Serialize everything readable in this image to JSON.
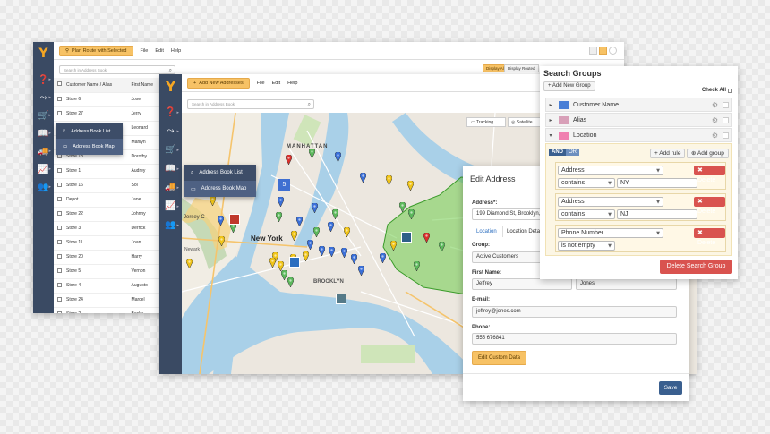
{
  "win1": {
    "route_button": "Plan Route with Selected",
    "menu": [
      "File",
      "Edit",
      "Help"
    ],
    "search_placeholder": "Search in Address Book",
    "display_all": "Display All",
    "display_routed": "Display Routed",
    "columns": [
      "Customer Name / Alias",
      "First Name"
    ],
    "rows": [
      [
        "Store 6",
        "Jose"
      ],
      [
        "Store 27",
        "Jerry"
      ],
      [
        "Store 13",
        "Leonard"
      ],
      [
        "Store 9",
        "Marilyn"
      ],
      [
        "Store 18",
        "Dorothy"
      ],
      [
        "Store 1",
        "Audrey"
      ],
      [
        "Store 16",
        "Sol"
      ],
      [
        "Depot",
        "Jane"
      ],
      [
        "Store 22",
        "Johnny"
      ],
      [
        "Store 3",
        "Derrick"
      ],
      [
        "Store 11",
        "Joan"
      ],
      [
        "Store 20",
        "Harry"
      ],
      [
        "Store 5",
        "Vernon"
      ],
      [
        "Store 4",
        "Augusto"
      ],
      [
        "Store 24",
        "Marcel"
      ],
      [
        "Store 2",
        "Becky"
      ]
    ],
    "flyout": [
      "Address Book List",
      "Address Book Map"
    ]
  },
  "win2": {
    "add_button": "Add New Addresses",
    "menu": [
      "File",
      "Edit",
      "Help"
    ],
    "search_placeholder": "Search in Address Book",
    "map_tracking": "Tracking",
    "map_satellite": "Satellite",
    "flyout": [
      "Address Book List",
      "Address Book Map"
    ],
    "map_labels": {
      "ny": "New York",
      "brooklyn": "BROOKLYN",
      "manhattan": "MANHATTAN",
      "jersey": "Jersey C",
      "newark": "Newark"
    }
  },
  "edit": {
    "title": "Edit Address",
    "address_label": "Address*:",
    "address_value": "199 Diamond St, Brooklyn, N",
    "tabs": [
      "Location",
      "Location Deta"
    ],
    "group_label": "Group:",
    "group_value": "Active Customers",
    "first_name_label": "First Name:",
    "first_name": "Jeffrey",
    "last_name": "Jones",
    "email_label": "E-mail:",
    "email": "jeffrey@jones.com",
    "phone_label": "Phone:",
    "phone": "555 676841",
    "custom_data": "Edit Custom Data",
    "save": "Save"
  },
  "search_groups": {
    "title": "Search Groups",
    "add_group": "Add New Group",
    "check_all": "Check All",
    "groups": [
      {
        "name": "Customer Name",
        "color": "#4a7fd6"
      },
      {
        "name": "Alias",
        "color": "#d8a0b8"
      },
      {
        "name": "Location",
        "color": "#f080b0"
      }
    ],
    "and_label": "AND",
    "or_label": "OR",
    "add_rule": "Add rule",
    "add_group_btn": "Add group",
    "rules": [
      {
        "field": "Address",
        "op": "contains",
        "value": "NY"
      },
      {
        "field": "Address",
        "op": "contains",
        "value": "NJ"
      },
      {
        "field": "Phone Number",
        "op": "is not empty",
        "value": ""
      }
    ],
    "delete": "Delete",
    "delete_group": "Delete Search Group"
  }
}
